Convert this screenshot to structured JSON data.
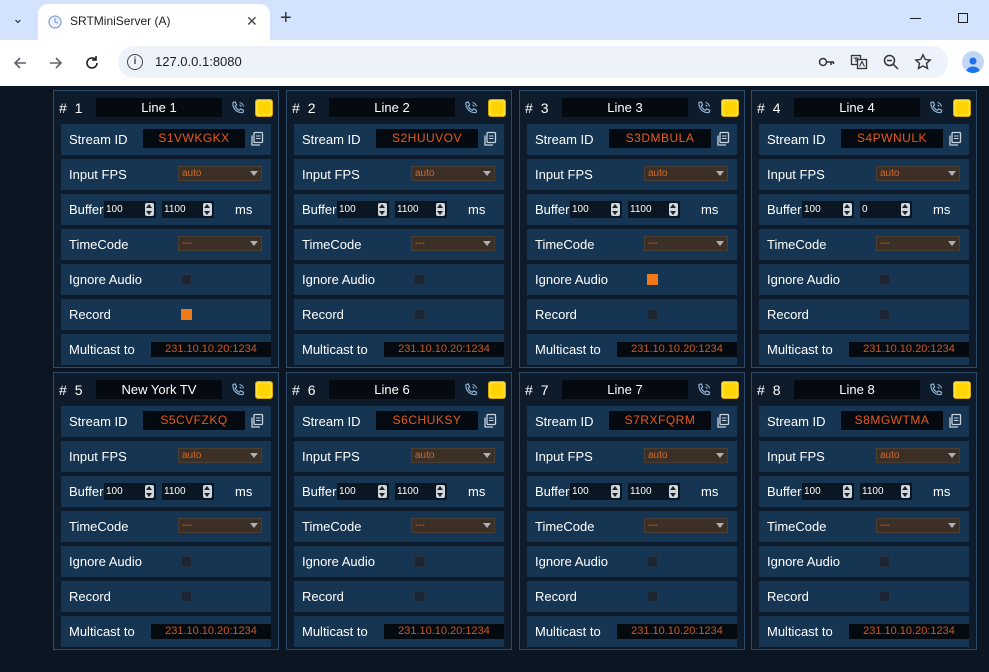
{
  "browser": {
    "tab_title": "SRTMiniServer (A)",
    "url": "127.0.0.1:8080"
  },
  "labels": {
    "hash": "#",
    "stream_id": "Stream ID",
    "input_fps": "Input FPS",
    "buffer": "Buffer",
    "ms": "ms",
    "timecode": "TimeCode",
    "ignore_audio": "Ignore Audio",
    "record": "Record",
    "multicast": "Multicast to"
  },
  "colors": {
    "accent_orange": "#f07a1a",
    "indicator_yellow": "#ffd400",
    "row_bg": "#163552"
  },
  "lines": [
    {
      "number": "1",
      "name": "Line 1",
      "stream_id": "S1VWKGKX",
      "fps": "auto",
      "buffer_min": "100",
      "buffer_max": "1100",
      "timecode": "---",
      "ignore_audio": false,
      "record": true,
      "multicast": "231.10.10.20:1234"
    },
    {
      "number": "2",
      "name": "Line 2",
      "stream_id": "S2HUUVOV",
      "fps": "auto",
      "buffer_min": "100",
      "buffer_max": "1100",
      "timecode": "---",
      "ignore_audio": false,
      "record": false,
      "multicast": "231.10.10.20:1234"
    },
    {
      "number": "3",
      "name": "Line 3",
      "stream_id": "S3DMBULA",
      "fps": "auto",
      "buffer_min": "100",
      "buffer_max": "1100",
      "timecode": "---",
      "ignore_audio": true,
      "record": false,
      "multicast": "231.10.10.20:1234"
    },
    {
      "number": "4",
      "name": "Line 4",
      "stream_id": "S4PWNULK",
      "fps": "auto",
      "buffer_min": "100",
      "buffer_max": "0",
      "timecode": "---",
      "ignore_audio": false,
      "record": false,
      "multicast": "231.10.10.20:1234"
    },
    {
      "number": "5",
      "name": "New York TV",
      "stream_id": "S5CVFZKQ",
      "fps": "auto",
      "buffer_min": "100",
      "buffer_max": "1100",
      "timecode": "---",
      "ignore_audio": false,
      "record": false,
      "multicast": "231.10.10.20:1234"
    },
    {
      "number": "6",
      "name": "Line 6",
      "stream_id": "S6CHUKSY",
      "fps": "auto",
      "buffer_min": "100",
      "buffer_max": "1100",
      "timecode": "---",
      "ignore_audio": false,
      "record": false,
      "multicast": "231.10.10.20:1234"
    },
    {
      "number": "7",
      "name": "Line 7",
      "stream_id": "S7RXFQRM",
      "fps": "auto",
      "buffer_min": "100",
      "buffer_max": "1100",
      "timecode": "---",
      "ignore_audio": false,
      "record": false,
      "multicast": "231.10.10.20:1234"
    },
    {
      "number": "8",
      "name": "Line 8",
      "stream_id": "S8MGWTMA",
      "fps": "auto",
      "buffer_min": "100",
      "buffer_max": "1100",
      "timecode": "---",
      "ignore_audio": false,
      "record": false,
      "multicast": "231.10.10.20:1234"
    }
  ]
}
